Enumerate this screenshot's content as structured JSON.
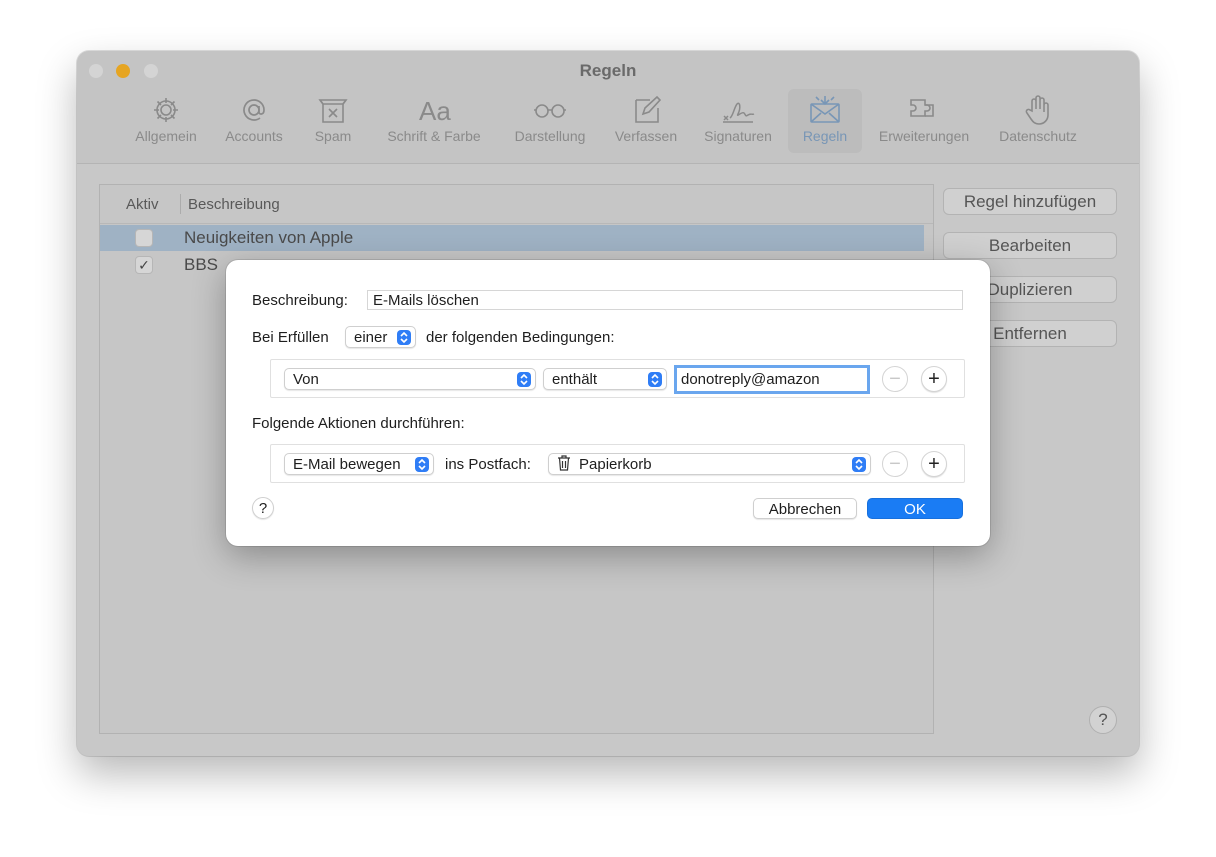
{
  "window": {
    "title": "Regeln"
  },
  "toolbar": {
    "items": [
      {
        "label": "Allgemein",
        "icon": "gear-icon"
      },
      {
        "label": "Accounts",
        "icon": "at-icon"
      },
      {
        "label": "Spam",
        "icon": "junk-tray-icon"
      },
      {
        "label": "Schrift & Farbe",
        "icon": "font-icon"
      },
      {
        "label": "Darstellung",
        "icon": "glasses-icon"
      },
      {
        "label": "Verfassen",
        "icon": "compose-icon"
      },
      {
        "label": "Signaturen",
        "icon": "signature-icon"
      },
      {
        "label": "Regeln",
        "icon": "rules-envelope-icon",
        "active": true
      },
      {
        "label": "Erweiterungen",
        "icon": "extension-icon"
      },
      {
        "label": "Datenschutz",
        "icon": "hand-icon"
      }
    ]
  },
  "rules_table": {
    "col_active": "Aktiv",
    "col_description": "Beschreibung",
    "rows": [
      {
        "name": "Neuigkeiten von Apple",
        "active": false,
        "selected": true
      },
      {
        "name": "BBS",
        "active": true,
        "selected": false
      }
    ]
  },
  "side_buttons": {
    "add": "Regel hinzufügen",
    "edit": "Bearbeiten",
    "duplicate": "Duplizieren",
    "remove": "Entfernen"
  },
  "help_label": "?",
  "sheet": {
    "description_label": "Beschreibung:",
    "description_value": "E-Mails löschen",
    "condition_prefix": "Bei Erfüllen",
    "condition_mode": "einer",
    "condition_suffix": "der folgenden Bedingungen:",
    "condition": {
      "field": "Von",
      "operator": "enthält",
      "value": "donotreply@amazon"
    },
    "actions_label": "Folgende Aktionen durchführen:",
    "action": {
      "type": "E-Mail bewegen",
      "to_label": "ins Postfach:",
      "mailbox": "Papierkorb"
    },
    "minus": "−",
    "plus": "+",
    "cancel": "Abbrechen",
    "ok": "OK",
    "help": "?"
  },
  "colors": {
    "accent": "#1a7cf4",
    "selected_row": "#9fb2c4",
    "minimize": "#e6a522"
  }
}
